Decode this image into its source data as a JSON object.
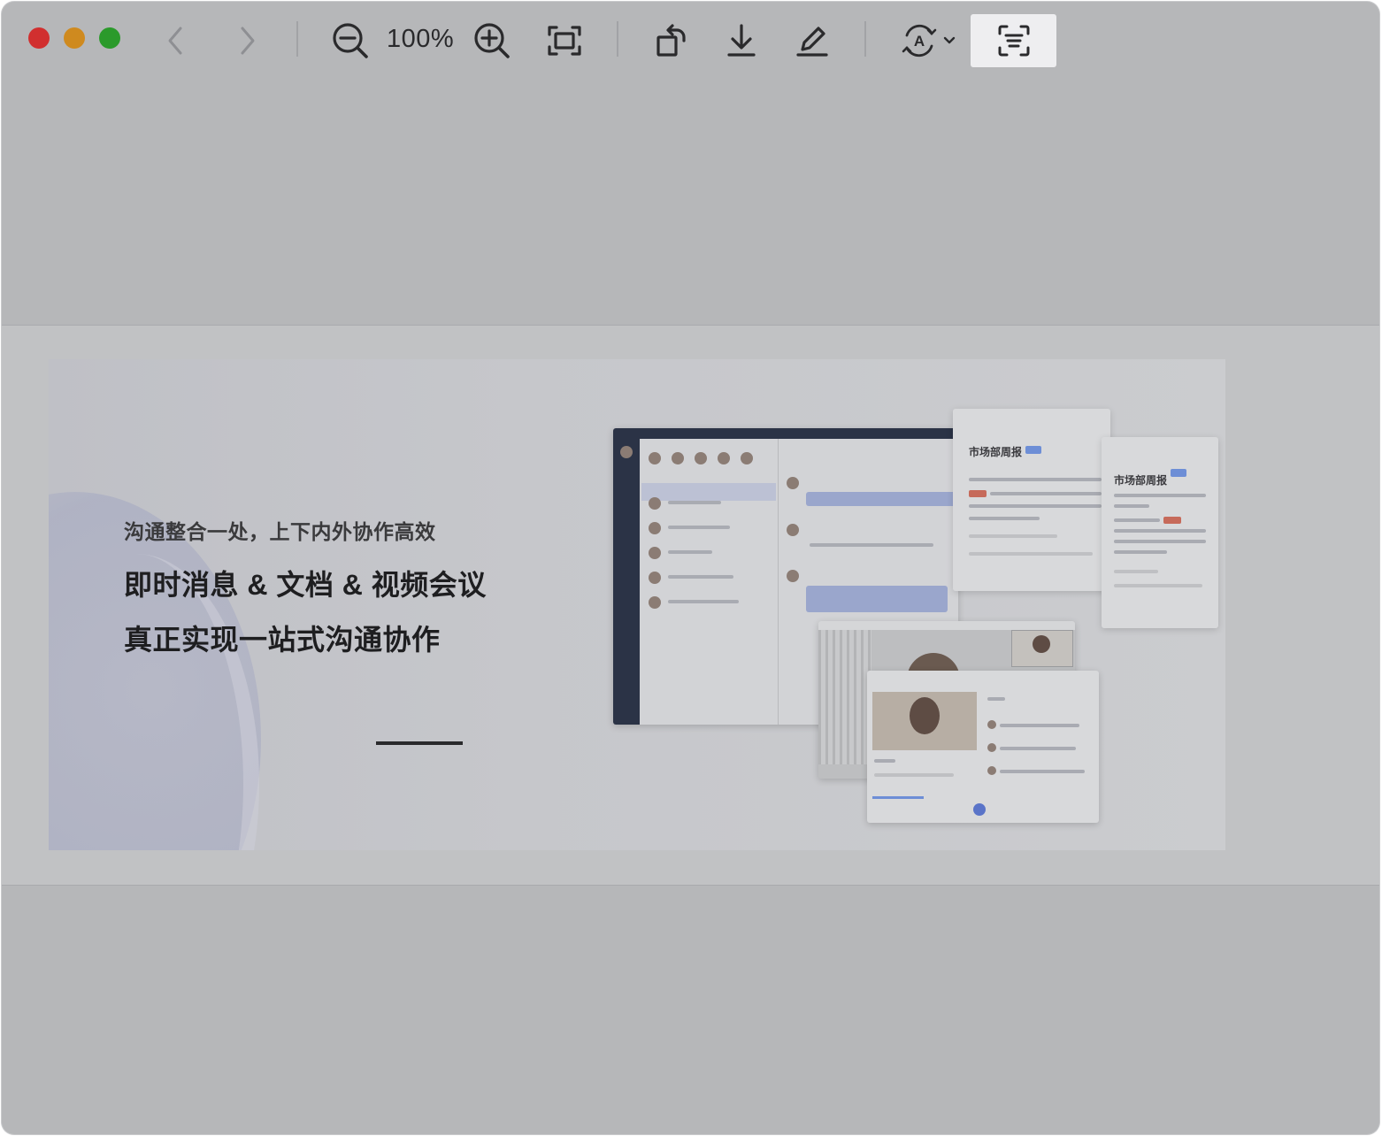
{
  "toolbar": {
    "zoom_level": "100%",
    "buttons": [
      "back",
      "forward",
      "zoom-out",
      "zoom-in",
      "fit-to-window",
      "rotate",
      "download",
      "markup",
      "auto-translate",
      "live-text"
    ]
  },
  "banner": {
    "subtitle": "沟通整合一处，上下内外协作高效",
    "headline_line1": "即时消息 & 文档 & 视频会议",
    "headline_line2": "真正实现一站式沟通协作",
    "doc_title_1": "市场部周报",
    "doc_title_2": "市场部周报"
  },
  "colors": {
    "window_bg": "#b6b7b9",
    "close": "#d12f2f",
    "minimize": "#cf8a1f",
    "zoom": "#2b9a2b",
    "active_button_bg": "#eeeef0"
  }
}
